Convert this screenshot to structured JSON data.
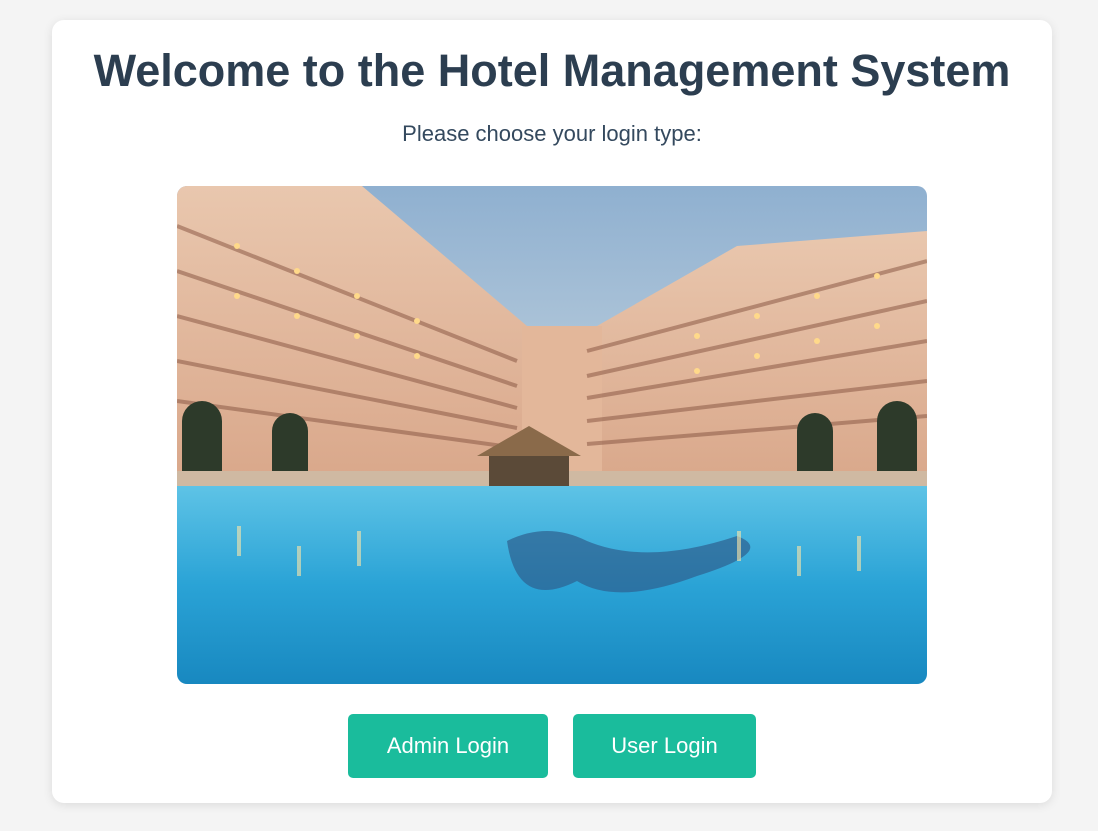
{
  "page": {
    "title": "Welcome to the Hotel Management System",
    "subtitle": "Please choose your login type:"
  },
  "hero_image": {
    "subject": "hotel-pool-photo"
  },
  "buttons": {
    "admin_label": "Admin Login",
    "user_label": "User Login"
  },
  "colors": {
    "background": "#f4f4f4",
    "card": "#ffffff",
    "title_text": "#2c3e50",
    "button": "#1abc9c",
    "button_text": "#ffffff"
  }
}
